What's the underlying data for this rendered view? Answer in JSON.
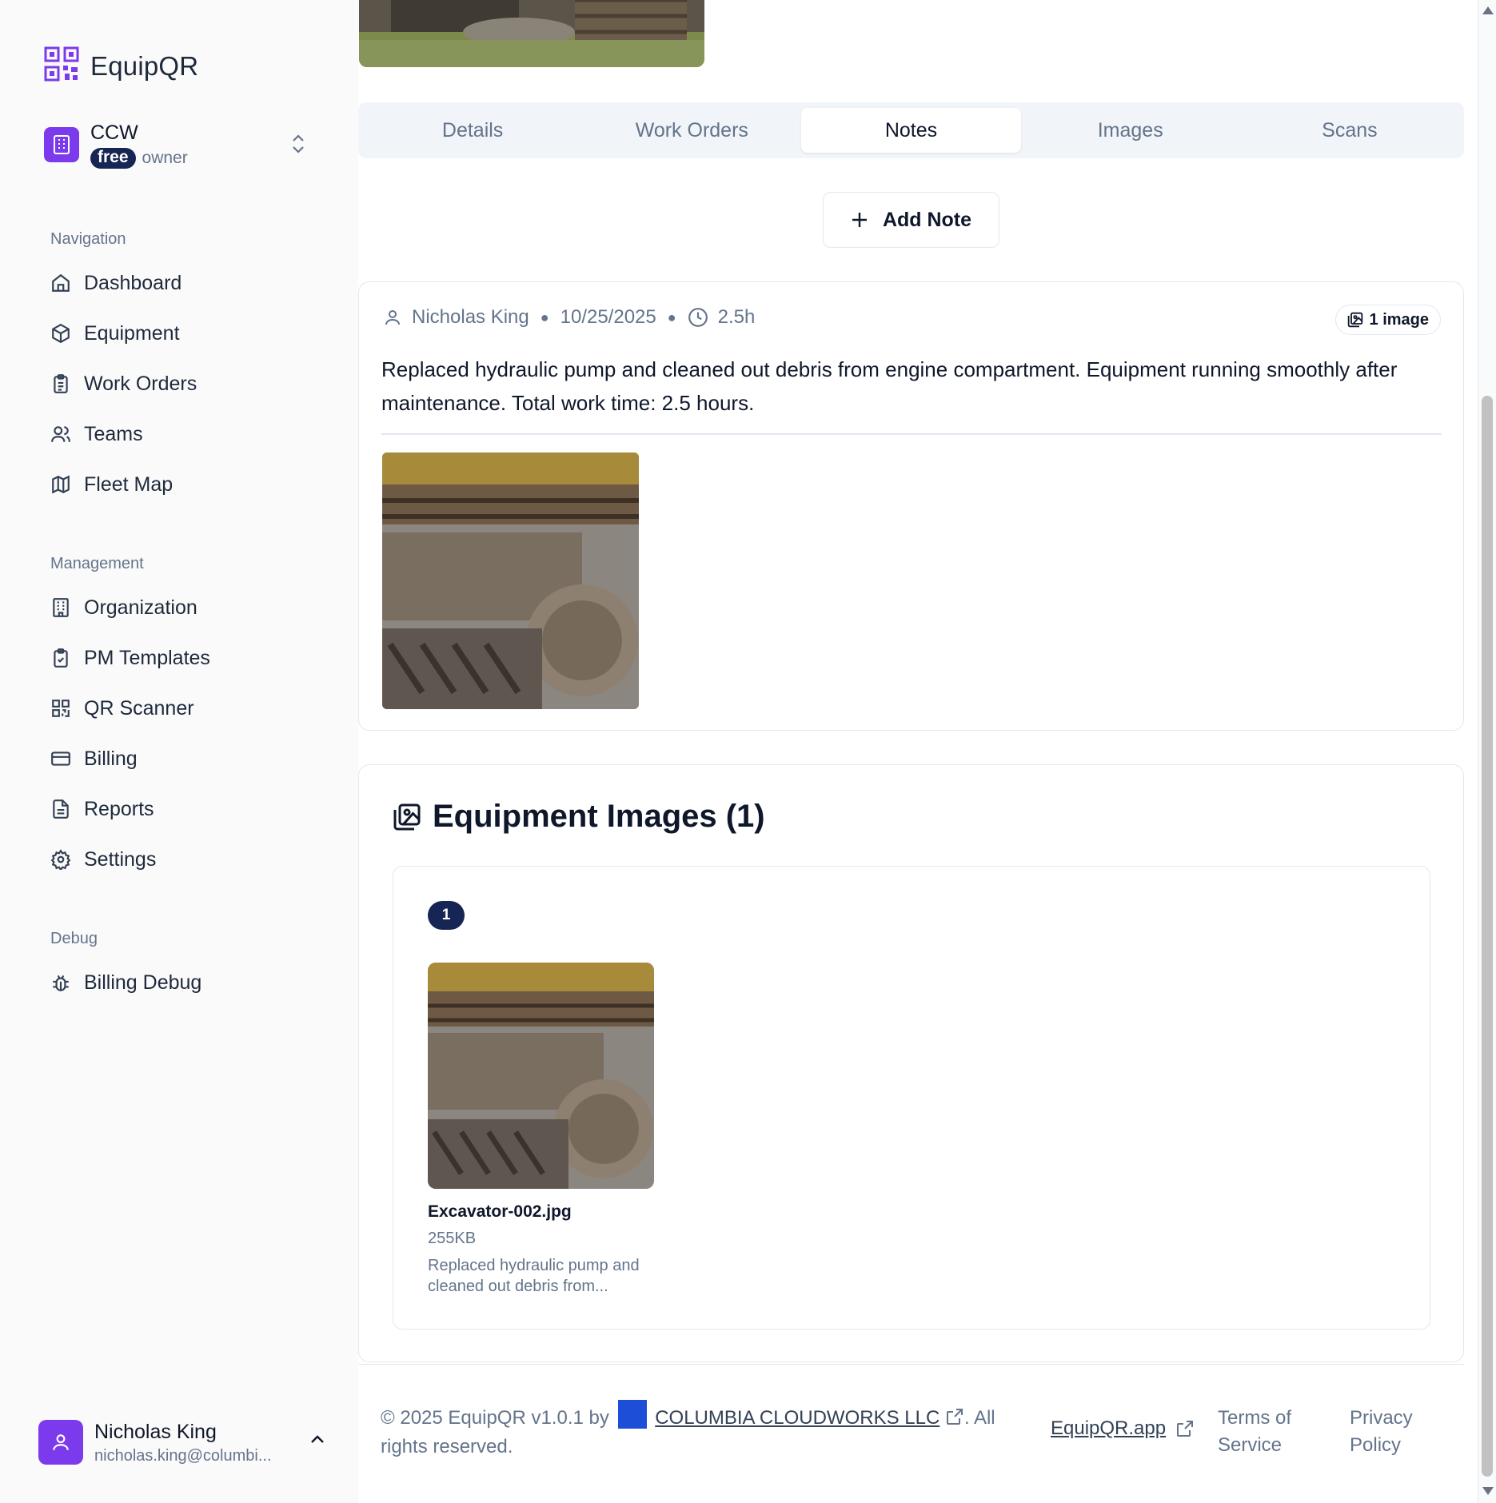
{
  "app": {
    "name": "EquipQR",
    "accent": "#7c3aed",
    "badge_dark": "#172554"
  },
  "org": {
    "name": "CCW",
    "plan": "free",
    "role": "owner"
  },
  "sidebar": {
    "sections": [
      {
        "label": "Navigation"
      },
      {
        "label": "Management"
      },
      {
        "label": "Debug"
      }
    ],
    "items": [
      {
        "label": "Dashboard",
        "icon": "home-icon"
      },
      {
        "label": "Equipment",
        "icon": "box-icon"
      },
      {
        "label": "Work Orders",
        "icon": "clipboard-list-icon"
      },
      {
        "label": "Teams",
        "icon": "users-icon"
      },
      {
        "label": "Fleet Map",
        "icon": "map-icon"
      },
      {
        "label": "Organization",
        "icon": "building-icon"
      },
      {
        "label": "PM Templates",
        "icon": "clipboard-check-icon"
      },
      {
        "label": "QR Scanner",
        "icon": "qr-code-icon"
      },
      {
        "label": "Billing",
        "icon": "credit-card-icon"
      },
      {
        "label": "Reports",
        "icon": "file-text-icon"
      },
      {
        "label": "Settings",
        "icon": "gear-icon"
      },
      {
        "label": "Billing Debug",
        "icon": "bug-icon"
      }
    ]
  },
  "user": {
    "name": "Nicholas King",
    "email": "nicholas.king@columbi..."
  },
  "tabs": [
    {
      "label": "Details"
    },
    {
      "label": "Work Orders"
    },
    {
      "label": "Notes",
      "active": true
    },
    {
      "label": "Images"
    },
    {
      "label": "Scans"
    }
  ],
  "notes": {
    "add_label": "Add Note",
    "items": [
      {
        "author": "Nicholas King",
        "date": "10/25/2025",
        "hours": "2.5h",
        "image_count": "1 image",
        "body": "Replaced hydraulic pump and cleaned out debris from engine compartment. Equipment running smoothly after maintenance. Total work time: 2.5 hours."
      }
    ]
  },
  "equipment_images": {
    "title": "Equipment Images (1)",
    "badge": "1",
    "items": [
      {
        "file_name": "Excavator-002.jpg",
        "size": "255KB",
        "description": "Replaced hydraulic pump and cleaned out debris from..."
      }
    ]
  },
  "footer": {
    "copyright_prefix": "© 2025 EquipQR v1.0.1 by",
    "company": "COLUMBIA CLOUDWORKS LLC",
    "copyright_suffix": ". All rights reserved.",
    "app_link": "EquipQR.app",
    "terms": "Terms of Service",
    "privacy": "Privacy Policy"
  }
}
